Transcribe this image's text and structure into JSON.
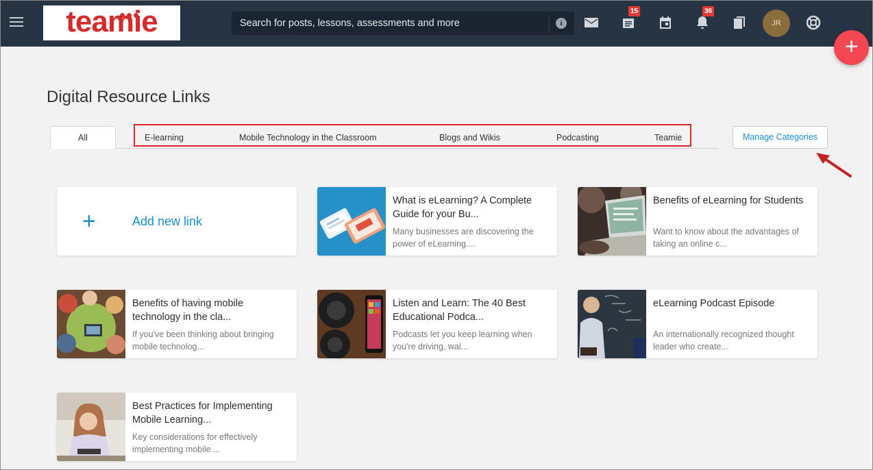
{
  "header": {
    "logo_text": "teamie",
    "search_placeholder": "Search for posts, lessons, assessments and more",
    "info_label": "i",
    "badges": {
      "posts": "15",
      "notifications": "36"
    },
    "avatar_initials": "JR",
    "fab_label": "+"
  },
  "page": {
    "title": "Digital Resource Links"
  },
  "tabs": {
    "all": "All",
    "categories": [
      "E-learning",
      "Mobile Technology in the Classroom",
      "Blogs and Wikis",
      "Podcasting",
      "Teamie"
    ],
    "manage_label": "Manage Categories"
  },
  "add_link": {
    "plus": "+",
    "label": "Add new link"
  },
  "cards": [
    {
      "title": "What is eLearning? A Complete Guide for your Bu...",
      "desc": "Many businesses are discovering the power of eLearning...."
    },
    {
      "title": "Benefits of eLearning for Students",
      "desc": "Want to know about the advantages of taking an online c..."
    },
    {
      "title": "Benefits of having mobile technology in the cla...",
      "desc": "If you've been thinking about bringing mobile technolog..."
    },
    {
      "title": "Listen and Learn: The 40 Best Educational Podca...",
      "desc": "Podcasts let you keep learning when you're driving, wal..."
    },
    {
      "title": "eLearning Podcast Episode",
      "desc": "An internationally recognized thought leader who create..."
    },
    {
      "title": "Best Practices for Implementing Mobile Learning...",
      "desc": "Key considerations for effectively implementing mobile ..."
    }
  ],
  "colors": {
    "topbar": "#263444",
    "accent": "#1a8ccd",
    "fab": "#f44651",
    "annotation_red": "#d9242b"
  },
  "icons": [
    "menu-icon",
    "info-icon",
    "mail-icon",
    "posts-icon",
    "calendar-icon",
    "bell-icon",
    "pages-icon",
    "help-icon",
    "plus-icon"
  ]
}
